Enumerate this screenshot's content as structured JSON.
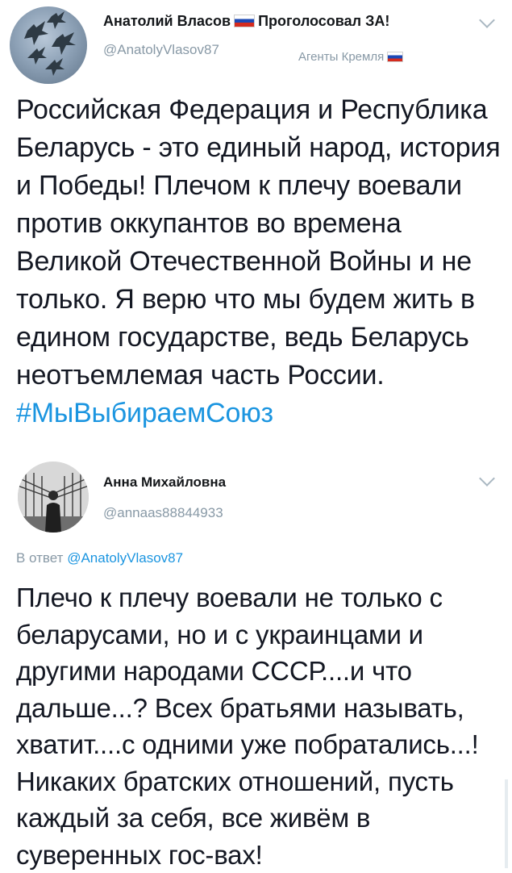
{
  "tweet1": {
    "author_name": "Анатолий Власов",
    "name_suffix": "Проголосовал ЗА!",
    "handle": "@AnatolyVlasov87",
    "group_label": "Агенты Кремля",
    "avatar_icon": "fighter-jets-icon",
    "text": "Российская Федерация и Республика Беларусь - это единый народ, история и Победы! Плечом к плечу воевали против оккупантов во времена Великой Отечественной Войны и не только. Я верю что мы будем жить в едином государстве, ведь Беларусь неотъемлемая часть России.",
    "hashtag": "#МыВыбираемСоюз"
  },
  "tweet2": {
    "author_name": "Анна Михайловна",
    "handle": "@annaas88844933",
    "avatar_icon": "person-in-hall-icon",
    "reply_prefix": "В ответ",
    "reply_mention": "@AnatolyVlasov87",
    "text": "Плечо к плечу воевали не только с беларусами, но и с украинцами и другими народами СССР....и что дальше...? Всех братьями называть, хватит....с одними уже побратались...! Никаких братских отношений, пусть каждый за себя, все живём в суверенных гос-вах!"
  },
  "colors": {
    "link": "#1b95e0",
    "secondary_text": "#8899a6",
    "primary_text": "#141823",
    "flag_white": "#ffffff",
    "flag_blue": "#1c48b5",
    "flag_red": "#d52b1e"
  }
}
